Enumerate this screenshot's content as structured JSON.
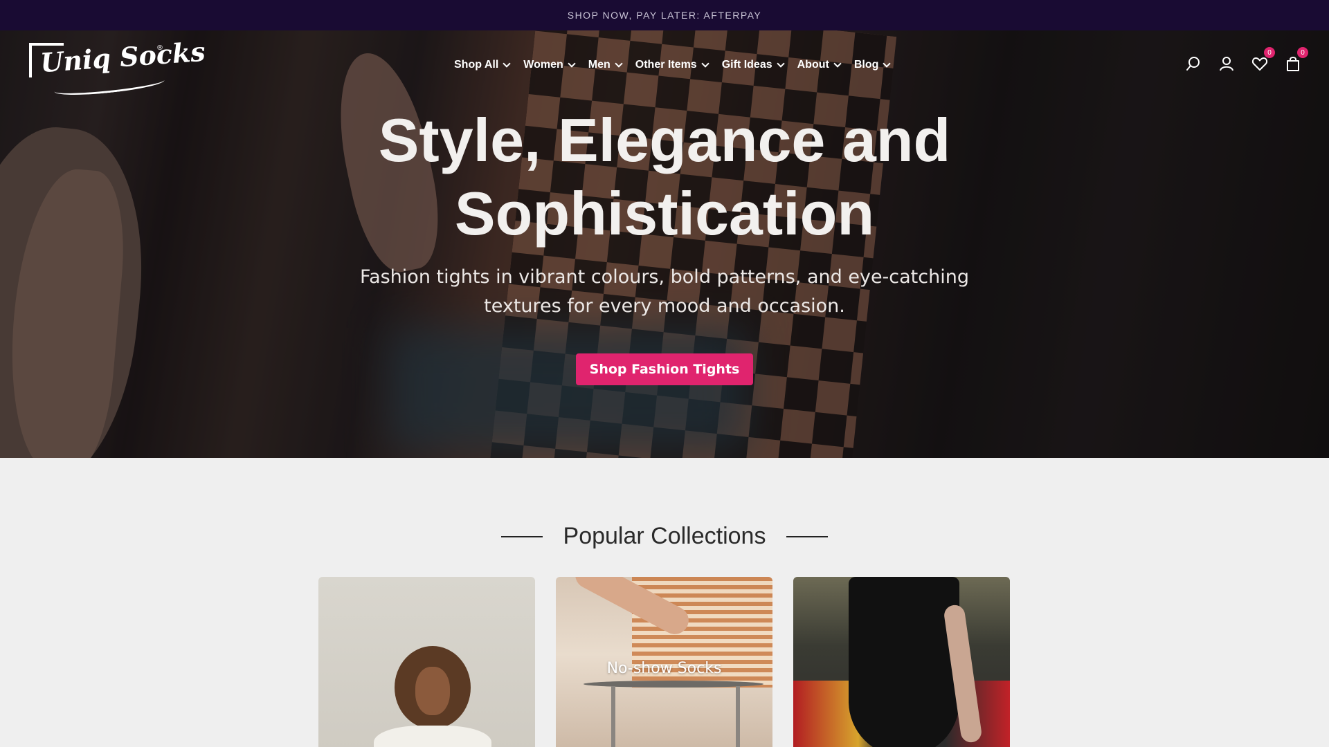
{
  "announcement": {
    "text": "SHOP NOW, PAY LATER: AFTERPAY"
  },
  "brand": {
    "name": "Uniq Socks",
    "logo_icon": "uniq-socks-logo"
  },
  "nav": {
    "items": [
      {
        "label": "Shop All"
      },
      {
        "label": "Women"
      },
      {
        "label": "Men"
      },
      {
        "label": "Other Items"
      },
      {
        "label": "Gift Ideas"
      },
      {
        "label": "About"
      },
      {
        "label": "Blog"
      }
    ]
  },
  "header_icons": {
    "search": "search-icon",
    "account": "user-icon",
    "wishlist": {
      "icon": "heart-icon",
      "count": "0"
    },
    "cart": {
      "icon": "bag-icon",
      "count": "0"
    }
  },
  "hero": {
    "title": "Style, Elegance and Sophistication",
    "subtitle": "Fashion tights in vibrant colours, bold patterns, and eye-catching textures for every mood and occasion.",
    "cta_label": "Shop Fashion Tights"
  },
  "collections": {
    "title": "Popular Collections",
    "cards": [
      {
        "label": ""
      },
      {
        "label": "No-show Socks"
      },
      {
        "label": ""
      }
    ]
  },
  "colors": {
    "announcement_bg": "#190b33",
    "accent": "#e0246e",
    "page_bg": "#efefef"
  }
}
